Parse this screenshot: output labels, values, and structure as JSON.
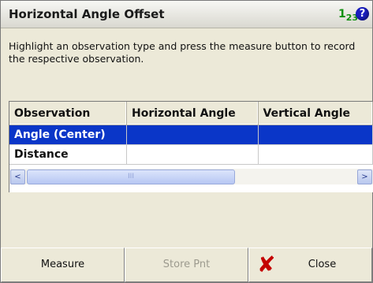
{
  "window": {
    "title": "Horizontal Angle Offset",
    "num_icon_main": "1",
    "num_icon_sub": "2",
    "num_icon_tail": "3",
    "help_glyph": "?"
  },
  "instructions": "Highlight an observation type and press the measure button to record the respective observation.",
  "table": {
    "headers": [
      "Observation",
      "Horizontal Angle",
      "Vertical Angle"
    ],
    "rows": [
      {
        "observation": "Angle (Center)",
        "horizontal": "",
        "vertical": "",
        "selected": true
      },
      {
        "observation": "Distance",
        "horizontal": "",
        "vertical": "",
        "selected": false
      }
    ]
  },
  "scrollbar": {
    "left_arrow": "<",
    "right_arrow": ">",
    "grip": "III"
  },
  "buttons": {
    "measure": "Measure",
    "store_pnt": "Store Pnt",
    "close": "Close",
    "close_glyph": "✘"
  },
  "colors": {
    "selection": "#0a36c8",
    "close_icon": "#c40000",
    "help_icon": "#1a1ec0"
  }
}
